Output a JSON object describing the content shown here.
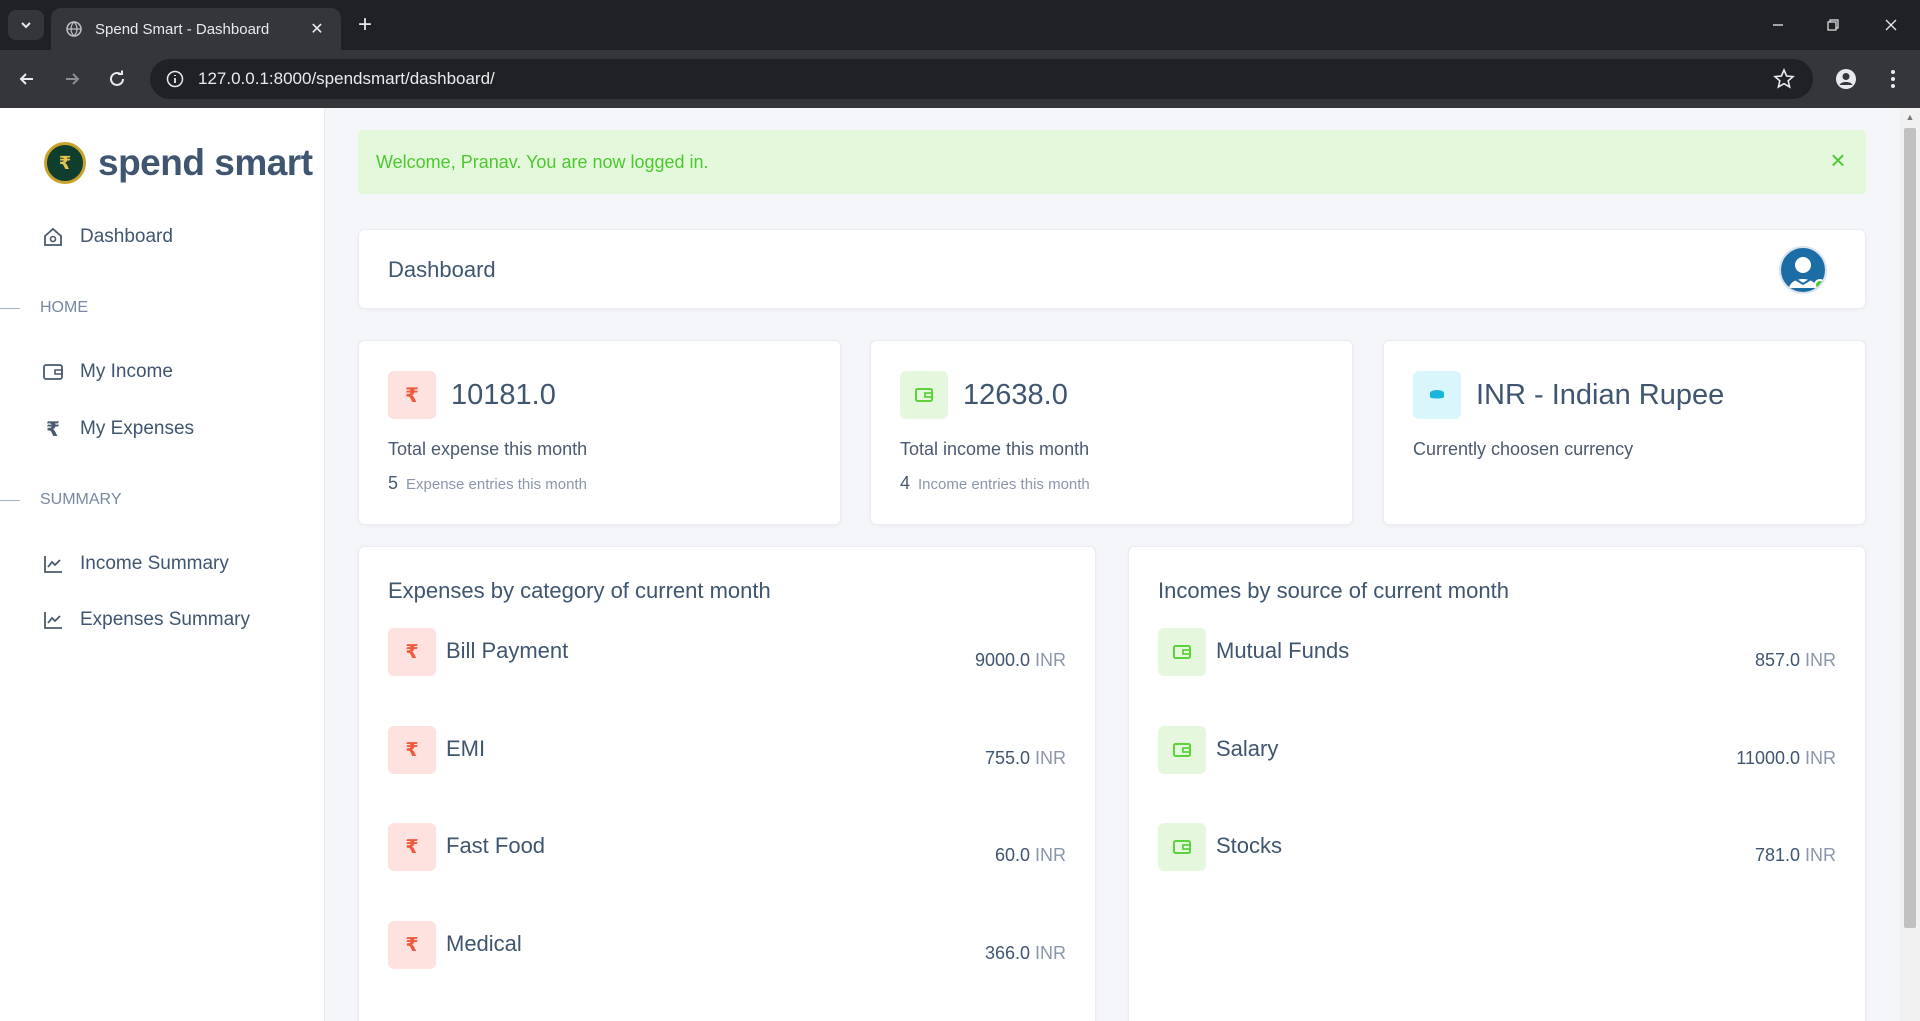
{
  "browser": {
    "tab_title": "Spend Smart - Dashboard",
    "url": "127.0.0.1:8000/spendsmart/dashboard/"
  },
  "sidebar": {
    "brand": "spend smart",
    "logo_symbol": "₹",
    "dashboard_label": "Dashboard",
    "section_home": "HOME",
    "my_income_label": "My Income",
    "my_expenses_label": "My Expenses",
    "section_summary": "SUMMARY",
    "income_summary_label": "Income Summary",
    "expenses_summary_label": "Expenses Summary"
  },
  "alert": {
    "message": "Welcome, Pranav. You are now logged in.",
    "close_symbol": "×"
  },
  "header": {
    "title": "Dashboard"
  },
  "stats": {
    "expense": {
      "symbol": "₹",
      "value": "10181.0",
      "label": "Total expense this month",
      "count": "5",
      "count_label": "Expense entries this month"
    },
    "income": {
      "value": "12638.0",
      "label": "Total income this month",
      "count": "4",
      "count_label": "Income entries this month"
    },
    "currency": {
      "value": "INR - Indian Rupee",
      "label": "Currently choosen currency"
    }
  },
  "expenses_by_category": {
    "title": "Expenses by category of current month",
    "currency": "INR",
    "symbol": "₹",
    "items": [
      {
        "name": "Bill Payment",
        "amount": "9000.0"
      },
      {
        "name": "EMI",
        "amount": "755.0"
      },
      {
        "name": "Fast Food",
        "amount": "60.0"
      },
      {
        "name": "Medical",
        "amount": "366.0"
      }
    ]
  },
  "incomes_by_source": {
    "title": "Incomes by source of current month",
    "currency": "INR",
    "items": [
      {
        "name": "Mutual Funds",
        "amount": "857.0"
      },
      {
        "name": "Salary",
        "amount": "11000.0"
      },
      {
        "name": "Stocks",
        "amount": "781.0"
      }
    ]
  },
  "colors": {
    "expense_accent": "#ef5a3c",
    "income_accent": "#5bd33c",
    "currency_accent": "#19b6dc",
    "alert_text": "#4cc92f"
  },
  "icons": {
    "expense": "rupee-icon",
    "income": "wallet-icon",
    "currency": "coins-icon",
    "dashboard": "home-icon",
    "summary": "chart-line-icon"
  }
}
